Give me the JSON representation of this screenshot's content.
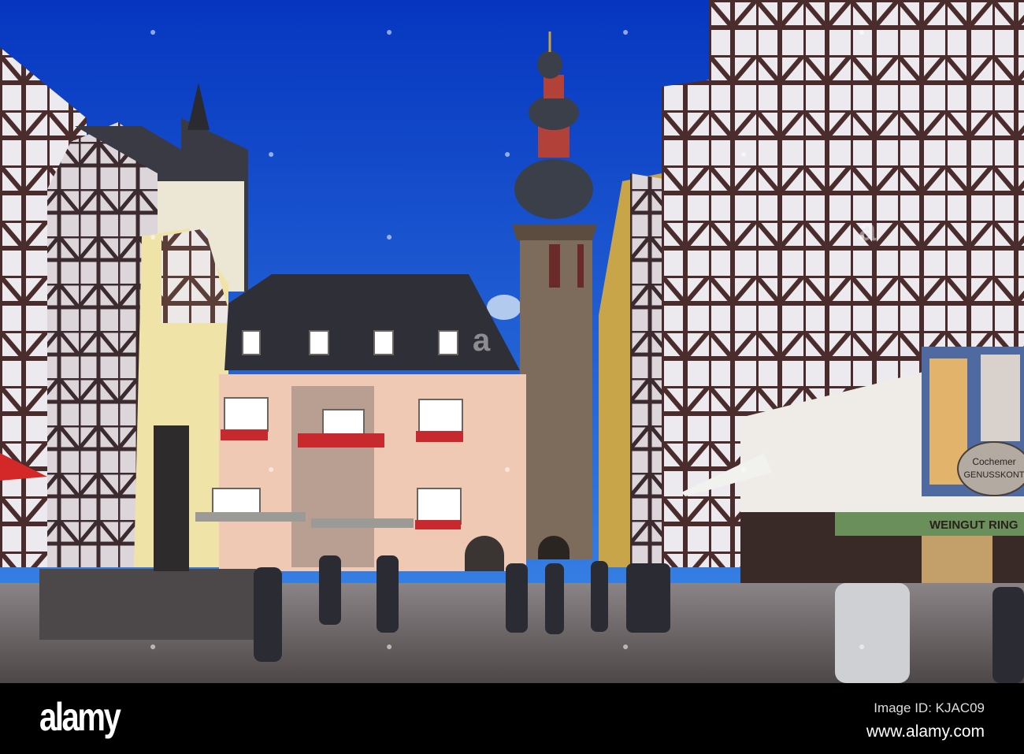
{
  "photo": {
    "subject": "Market square with half-timbered houses and tower",
    "signs": {
      "shop_oval_line1": "Cochemer",
      "shop_oval_line2": "GENUSSKONT",
      "weingut_banner": "WEINGUT RING",
      "watermark_letter": "a"
    },
    "colors": {
      "sky_top": "#0a3fc4",
      "sky_bottom": "#3a86e8",
      "town_hall": "#f0c9b4",
      "cobble": "#5f5a5a"
    }
  },
  "footer": {
    "logo": "alamy",
    "image_id": "Image ID: KJAC09",
    "website": "www.alamy.com"
  }
}
